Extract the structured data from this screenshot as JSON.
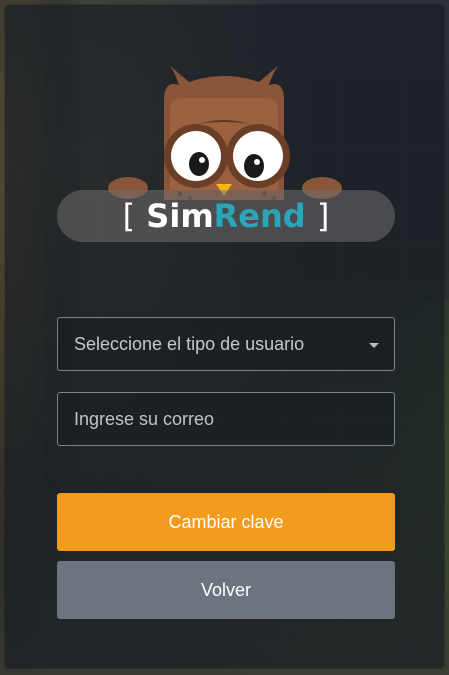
{
  "brand": {
    "bracket_open": "[",
    "name_part1": "Sim",
    "name_part2": "Rend",
    "bracket_close": "]",
    "accent_color": "#2aa6b8"
  },
  "form": {
    "user_type_select": {
      "selected_text": "Seleccione el tipo de usuario",
      "icon": "caret-down-icon"
    },
    "email_input": {
      "placeholder": "Ingrese su correo",
      "value": ""
    }
  },
  "actions": {
    "primary_label": "Cambiar clave",
    "primary_color": "#f29c1f",
    "secondary_label": "Volver",
    "secondary_color": "#6c7480"
  },
  "mascot": {
    "icon": "owl-mascot-icon"
  }
}
